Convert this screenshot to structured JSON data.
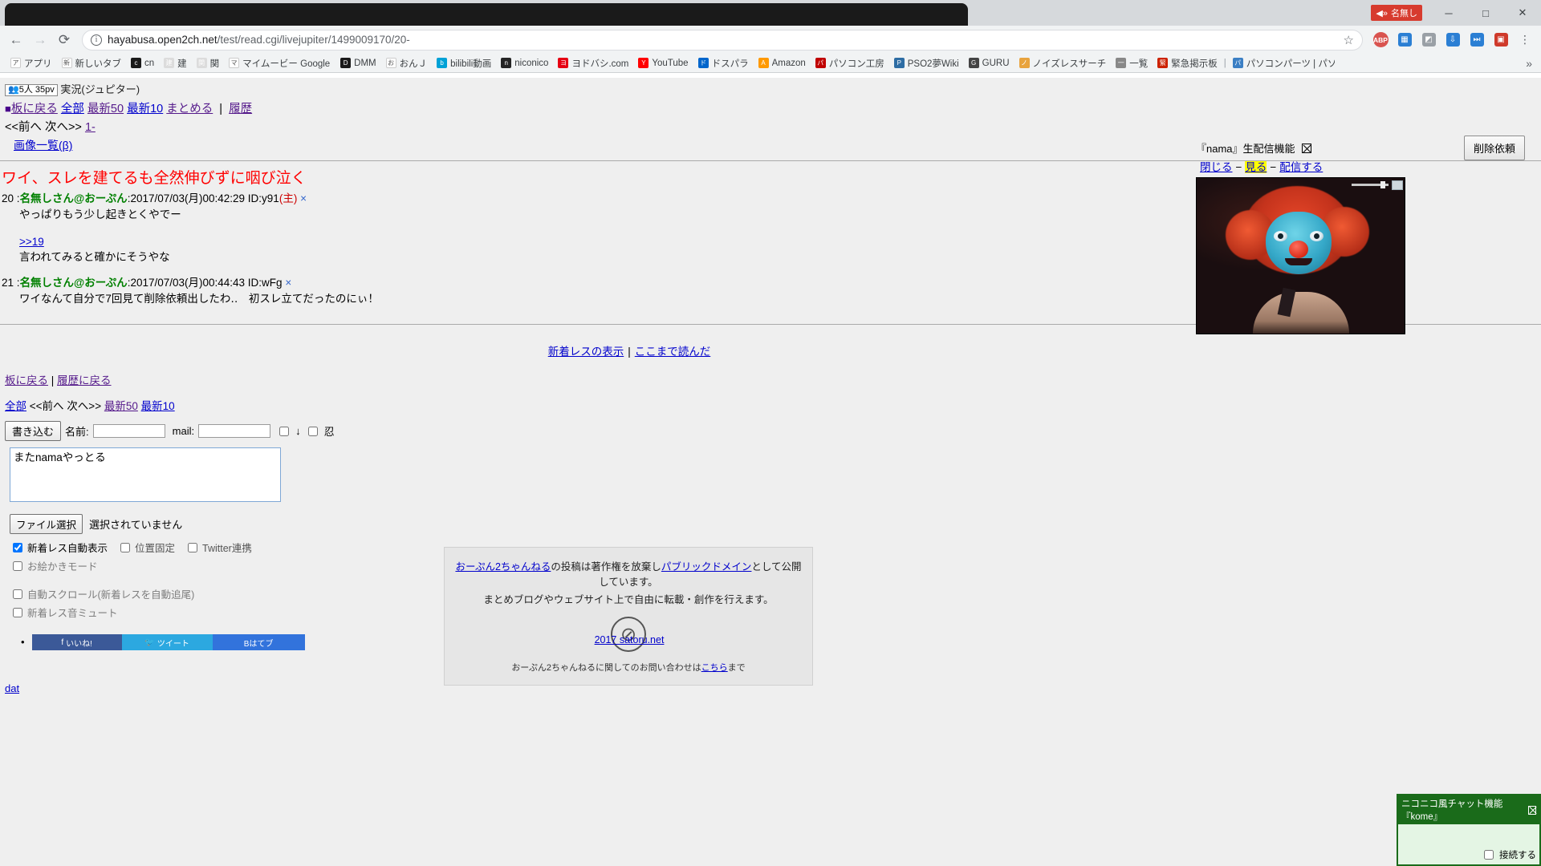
{
  "browser": {
    "url_host": "hayabusa.open2ch.net",
    "url_path": "/test/read.cgi/livejupiter/1499009170/20-",
    "back_icon": "←",
    "forward_icon": "→",
    "reload_icon": "⟳",
    "info_icon": "i",
    "star_icon": "☆",
    "menu_icon": "⋮",
    "minimize_icon": "─",
    "maximize_icon": "□",
    "close_icon": "✕",
    "mini_ext_label": "名無し",
    "abp_label": "ABP",
    "toolbar_icons": [
      "abp-icon",
      "extension-blue-icon",
      "extension-gray-icon",
      "extension-down-icon",
      "extension-forward-icon",
      "extension-red-icon",
      "chrome-menu-icon"
    ]
  },
  "bookmarks": [
    {
      "label": "アプリ",
      "fav": "apps-grid-icon",
      "color": "#ffffff"
    },
    {
      "label": "新しいタブ",
      "fav": "page-icon",
      "color": "#ffffff"
    },
    {
      "label": "cn",
      "fav": "dark-d-icon",
      "color": "#1a1a1a"
    },
    {
      "label": "建",
      "fav": "wiki-icon",
      "color": "#dcdcdc"
    },
    {
      "label": "関",
      "fav": "wiki2-icon",
      "color": "#dcdcdc"
    },
    {
      "label": "マイムービー Google Pla",
      "fav": "play-icon",
      "color": "#ffffff"
    },
    {
      "label": "DMM",
      "fav": "dark-d-icon",
      "color": "#1a1a1a"
    },
    {
      "label": "おんＪ",
      "fav": "openj-icon",
      "color": "#ffffff"
    },
    {
      "label": "bilibili動画",
      "fav": "bilibili-icon",
      "color": "#00a1d6"
    },
    {
      "label": "niconico",
      "fav": "niconico-icon",
      "color": "#252525"
    },
    {
      "label": "ヨドバシ.com",
      "fav": "yodobashi-icon",
      "color": "#e60012"
    },
    {
      "label": "YouTube",
      "fav": "youtube-icon",
      "color": "#ff0000"
    },
    {
      "label": "ドスパラ",
      "fav": "dospara-icon",
      "color": "#0066cc"
    },
    {
      "label": "Amazon",
      "fav": "amazon-icon",
      "color": "#ff9900"
    },
    {
      "label": "パソコン工房",
      "fav": "pckoubou-icon",
      "color": "#c00000"
    },
    {
      "label": "PSO2夢Wiki",
      "fav": "wiki3-icon",
      "color": "#2e6da4"
    },
    {
      "label": "GURU",
      "fav": "guru-icon",
      "color": "#444444"
    },
    {
      "label": "ノイズレスサーチ",
      "fav": "noiseless-icon",
      "color": "#e8a33d"
    },
    {
      "label": "一覧",
      "fav": "list-icon",
      "color": "#888888"
    },
    {
      "label": "緊急掲示板",
      "fav": "bbs-icon",
      "color": "#cc2200"
    },
    {
      "label": "パソコンパーツ | パソコン",
      "fav": "pcparts-icon",
      "color": "#3b7fc4"
    }
  ],
  "bookmark_overflow_icon": "»",
  "thread": {
    "counter": "5人 35pv",
    "counter_icon": "people-icon",
    "board_name": "実況(ジュピター)",
    "header_links": {
      "square": "■",
      "back_to_board": "板に戻る",
      "all": "全部",
      "latest50": "最新50",
      "latest10": "最新10",
      "summarize": "まとめる",
      "divider": "|",
      "history": "履歴"
    },
    "nav_row": {
      "prev": "<<前へ",
      "next": "次へ>>",
      "range": "1-"
    },
    "image_list": "画像一覧(β)",
    "title": "ワイ、スレを建てるも全然伸びずに咽び泣く",
    "posts": [
      {
        "num": "20",
        "colon": ":",
        "name": "名無しさん@おーぷん",
        "meta": ":2017/07/03(月)00:42:29 ID:y91",
        "nushi": "(主)",
        "x": "×",
        "body": "やっぱりもう少し起きとくやでー",
        "anchor": "",
        "anchor_body": ""
      },
      {
        "num": "",
        "colon": "",
        "name": "",
        "meta": "",
        "nushi": "",
        "x": "",
        "body": "",
        "anchor": ">>19",
        "anchor_body": "言われてみると確かにそうやな"
      },
      {
        "num": "21",
        "colon": ":",
        "name": "名無しさん@おーぷん",
        "meta": ":2017/07/03(月)00:44:43 ID:wFg",
        "nushi": "",
        "x": "×",
        "body": "ワイなんて自分で7回見て削除依頼出したわ‥　初スレ立てだったのにぃ！",
        "anchor": "",
        "anchor_body": ""
      }
    ],
    "center_links": {
      "show_new": "新着レスの表示",
      "bar": "|",
      "read_to_here": "ここまで読んだ"
    },
    "bottom_nav1": {
      "back_to_board": "板に戻る",
      "bar": "|",
      "back_to_history": "履歴に戻る"
    },
    "bottom_nav2": {
      "all": "全部",
      "prev": "<<前へ",
      "next": "次へ>>",
      "latest50": "最新50",
      "latest10": "最新10"
    },
    "dat_link": "dat"
  },
  "form": {
    "submit_label": "書き込む",
    "name_label": "名前:",
    "name_value": "",
    "mail_label": "mail:",
    "mail_value": "",
    "down_arrow": "↓",
    "shinobi_label": "忍",
    "textarea_value": "またnamaやっとる",
    "file_button": "ファイル選択",
    "file_status": "選択されていません",
    "options": [
      {
        "label": "新着レス自動表示",
        "checked": true
      },
      {
        "label": "位置固定",
        "checked": false
      },
      {
        "label": "Twitter連携",
        "checked": false
      }
    ],
    "option_draw": {
      "label": "お絵かきモード",
      "checked": false
    },
    "option_autoscroll": {
      "label": "自動スクロール(新着レスを自動追尾)",
      "checked": false
    },
    "option_mute": {
      "label": "新着レス音ミュート",
      "checked": false
    },
    "share": {
      "facebook": "いいね!",
      "twitter": "ツイート",
      "hatena": "Bはてブ"
    }
  },
  "license": {
    "line1_a": "おーぷん2ちゃんねる",
    "line1_b": "の投稿は著作権を放棄し",
    "line1_c": "パブリックドメイン",
    "line1_d": "として公開しています。",
    "line2": "まとめブログやウェブサイト上で自由に転載・創作を行えます。",
    "cc_icon": "⊘",
    "contact_a": "おーぷん2ちゃんねるに関してのお問い合わせは",
    "contact_b": "こちら",
    "contact_c": "まで"
  },
  "footer_link": "2017 satoru.net",
  "nama": {
    "title": "『nama』生配信機能",
    "close_icon": "close-box-icon",
    "link_close": "閉じる",
    "dash": "−",
    "link_watch": "見る",
    "link_stream": "配信する",
    "video_alt": "clown-mask-stream"
  },
  "delete_button": "削除依頼",
  "kome": {
    "title": "ニコニコ風チャット機能『kome』",
    "close_icon": "close-box-icon",
    "connect_label": "接続する",
    "connect_checked": false
  }
}
